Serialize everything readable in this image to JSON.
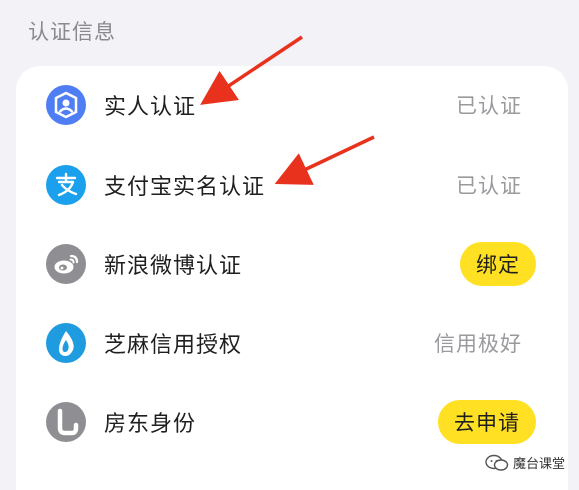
{
  "section": {
    "title": "认证信息"
  },
  "rows": [
    {
      "label": "实人认证",
      "status": "已认证",
      "icon": "face-id-icon",
      "color": "#4f7df3"
    },
    {
      "label": "支付宝实名认证",
      "status": "已认证",
      "icon": "alipay-icon",
      "color": "#1aa0ec"
    },
    {
      "label": "新浪微博认证",
      "action": "绑定",
      "icon": "weibo-icon",
      "color": "#8e8e93"
    },
    {
      "label": "芝麻信用授权",
      "status": "信用极好",
      "icon": "sesame-credit-icon",
      "color": "#1f9be0"
    },
    {
      "label": "房东身份",
      "action": "去申请",
      "icon": "landlord-icon",
      "color": "#8e8e93"
    }
  ],
  "colors": {
    "pill": "#ffe022",
    "arrow": "#e8321e"
  },
  "watermark": {
    "text": "魔台课堂",
    "icon": "wechat-icon"
  }
}
